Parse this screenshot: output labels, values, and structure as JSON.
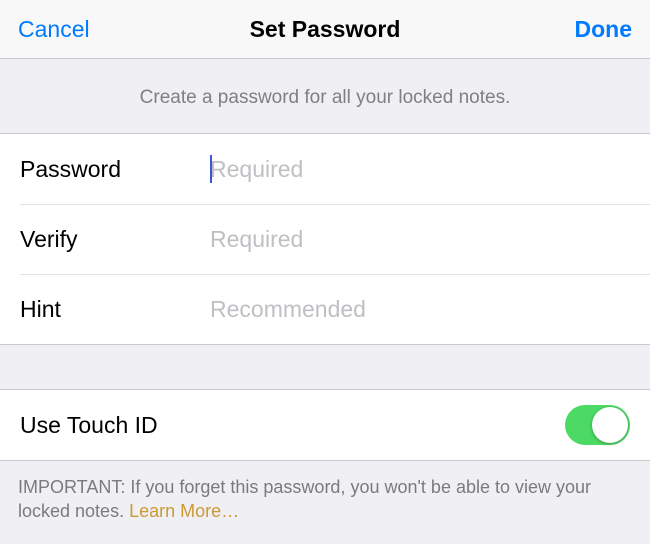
{
  "nav": {
    "cancel": "Cancel",
    "title": "Set Password",
    "done": "Done"
  },
  "header_text": "Create a password for all your locked notes.",
  "fields": {
    "password": {
      "label": "Password",
      "placeholder": "Required",
      "value": ""
    },
    "verify": {
      "label": "Verify",
      "placeholder": "Required",
      "value": ""
    },
    "hint": {
      "label": "Hint",
      "placeholder": "Recommended",
      "value": ""
    }
  },
  "touch_id": {
    "label": "Use Touch ID",
    "on": true
  },
  "footer": {
    "text": "IMPORTANT: If you forget this password, you won't be able to view your locked notes. ",
    "link": "Learn More…"
  },
  "colors": {
    "tint": "#007aff",
    "switch_on": "#4cd964",
    "link": "#cc9933"
  }
}
